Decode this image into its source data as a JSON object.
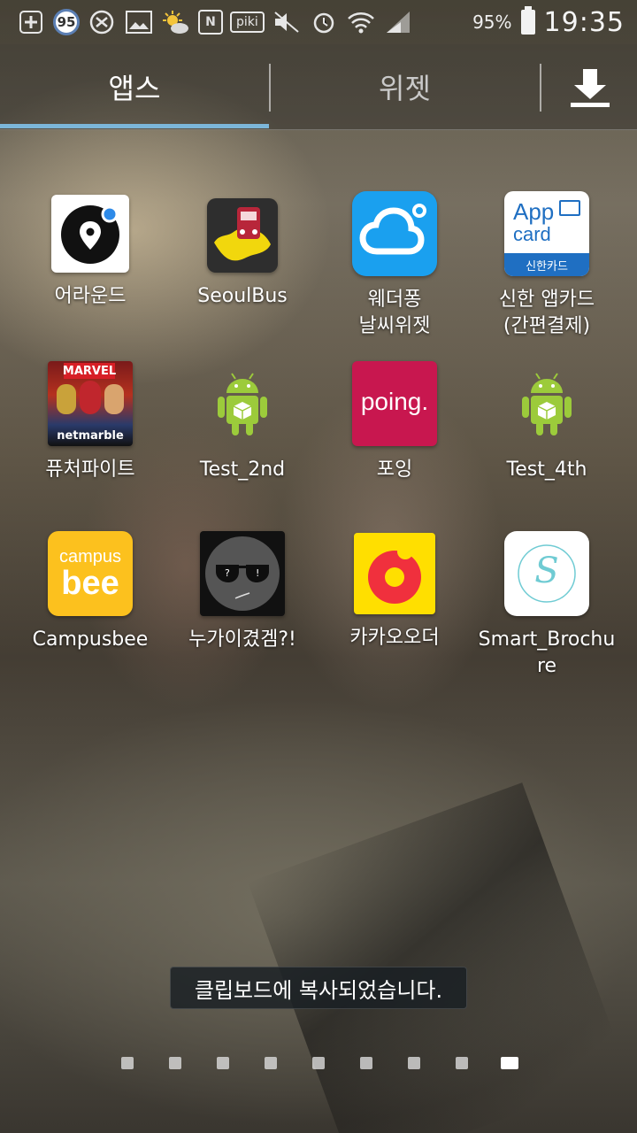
{
  "status_bar": {
    "badge_number": "95",
    "left_icons": [
      "plus-icon",
      "notification-badge",
      "shield-icon",
      "picture-icon",
      "weather-icon",
      "n-icon",
      "piki-icon",
      "mute-icon",
      "alarm-icon",
      "wifi-icon",
      "signal-icon"
    ],
    "n_label": "N",
    "piki_label": "piki",
    "battery_percent": "95%",
    "time": "19:35"
  },
  "tabs": {
    "apps": "앱스",
    "widgets": "위젯",
    "active": "apps",
    "accent_color": "#7cb6d9"
  },
  "apps": [
    {
      "label": "어라운드",
      "icon": "around-app-icon"
    },
    {
      "label": "SeoulBus",
      "icon": "seoulbus-app-icon"
    },
    {
      "label": "웨더퐁\n날씨위젯",
      "icon": "weatherpong-app-icon"
    },
    {
      "label": "신한 앱카드\n(간편결제)",
      "icon": "shinhan-appcard-icon",
      "icon_text_1": "App",
      "icon_text_2": "card",
      "icon_text_3": "신한카드"
    },
    {
      "label": "퓨처파이트",
      "icon": "futurefight-app-icon",
      "icon_text_1": "MARVEL",
      "icon_text_2": "netmarble"
    },
    {
      "label": "Test_2nd",
      "icon": "android-app-icon"
    },
    {
      "label": "포잉",
      "icon": "poing-app-icon",
      "icon_text_1": "poing."
    },
    {
      "label": "Test_4th",
      "icon": "android-app-icon"
    },
    {
      "label": "Campusbee",
      "icon": "campusbee-app-icon",
      "icon_text_1": "campus",
      "icon_text_2": "bee"
    },
    {
      "label": "누가이겼겜?!",
      "icon": "nugaigyeot-app-icon"
    },
    {
      "label": "카카오오더",
      "icon": "kakaoorder-app-icon"
    },
    {
      "label": "Smart_Brochu\nre",
      "icon": "smart-brochure-app-icon",
      "icon_text_1": "S"
    }
  ],
  "toast": "클립보드에 복사되었습니다.",
  "page_indicator": {
    "count": 9,
    "active": 9
  }
}
